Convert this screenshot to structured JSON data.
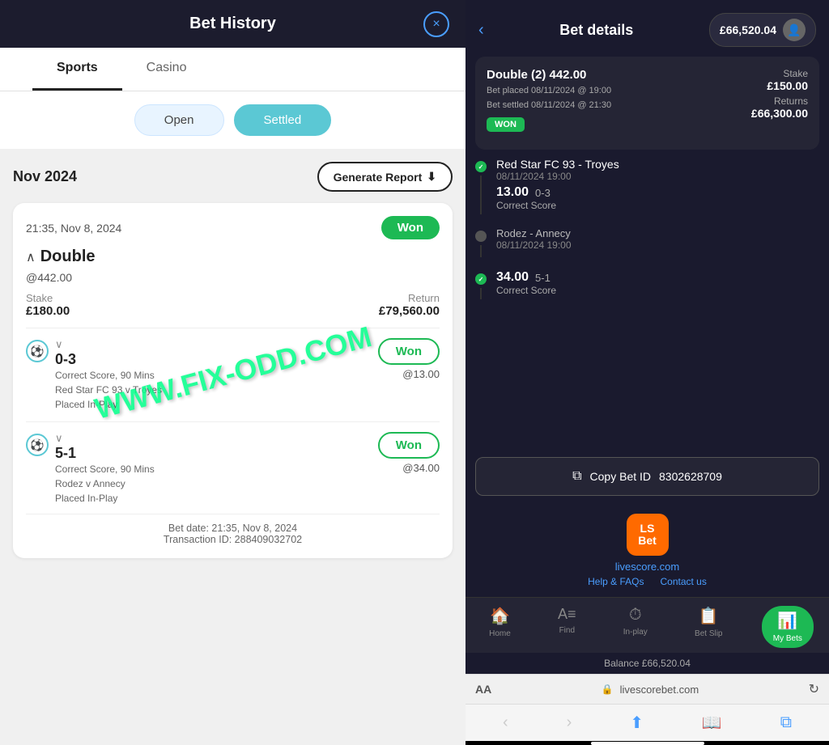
{
  "left": {
    "header": {
      "title": "Bet History",
      "close_label": "×"
    },
    "tabs": [
      {
        "id": "sports",
        "label": "Sports",
        "active": true
      },
      {
        "id": "casino",
        "label": "Casino",
        "active": false
      }
    ],
    "filters": [
      {
        "id": "open",
        "label": "Open",
        "active": false
      },
      {
        "id": "settled",
        "label": "Settled",
        "active": true
      }
    ],
    "month": "Nov 2024",
    "generate_report": "Generate Report",
    "bet": {
      "time": "21:35, Nov 8, 2024",
      "status": "Won",
      "type": "Double",
      "odds": "@442.00",
      "stake_label": "Stake",
      "stake_value": "£180.00",
      "return_label": "Return",
      "return_value": "£79,560.00",
      "selections": [
        {
          "score": "0-3",
          "desc_line1": "Correct Score, 90 Mins",
          "desc_line2": "Red Star FC 93 v Troyes",
          "desc_line3": "Placed In-Play",
          "odds": "@13.00",
          "status": "Won"
        },
        {
          "score": "5-1",
          "desc_line1": "Correct Score, 90 Mins",
          "desc_line2": "Rodez v Annecy",
          "desc_line3": "Placed In-Play",
          "odds": "@34.00",
          "status": "Won"
        }
      ],
      "footer_line1": "Bet date: 21:35, Nov 8, 2024",
      "footer_line2": "Transaction ID: 288409032702"
    },
    "watermark": "WWW.FIX-ODD.COM"
  },
  "right": {
    "header": {
      "back": "‹",
      "title": "Bet details",
      "balance": "£66,520.04"
    },
    "bet_details": {
      "title": "Double (2) 442.00",
      "placed": "Bet placed 08/11/2024 @ 19:00",
      "settled": "Bet settled 08/11/2024 @ 21:30",
      "status_tag": "WON",
      "stake_label": "Stake",
      "stake_value": "£150.00",
      "returns_label": "Returns",
      "returns_value": "£66,300.00"
    },
    "timeline": [
      {
        "match": "Red Star FC 93 - Troyes",
        "date": "08/11/2024 19:00",
        "score": "13.00",
        "result": "0-3",
        "type": "Correct Score",
        "won": true
      },
      {
        "match": "Rodez - Annecy",
        "date": "08/11/2024 19:00",
        "score": "34.00",
        "result": "5-1",
        "type": "Correct Score",
        "won": true
      }
    ],
    "copy_bet": {
      "label": "Copy Bet ID",
      "id": "8302628709"
    },
    "brand": {
      "logo_line1": "LS",
      "logo_line2": "Bet",
      "site": "livescore.com",
      "help": "Help & FAQs",
      "contact": "Contact us"
    },
    "nav": [
      {
        "icon": "🏠",
        "label": "Home",
        "active": false
      },
      {
        "icon": "🔤",
        "label": "Find",
        "active": false
      },
      {
        "icon": "⏱",
        "label": "In-play",
        "active": false
      },
      {
        "icon": "📋",
        "label": "Bet Slip",
        "active": false
      },
      {
        "icon": "📊",
        "label": "My Bets",
        "active": true
      }
    ],
    "balance_bar": "Balance  £66,520.04",
    "browser": {
      "aa": "AA",
      "url": "livescorebet.com",
      "reload": "↻"
    }
  }
}
